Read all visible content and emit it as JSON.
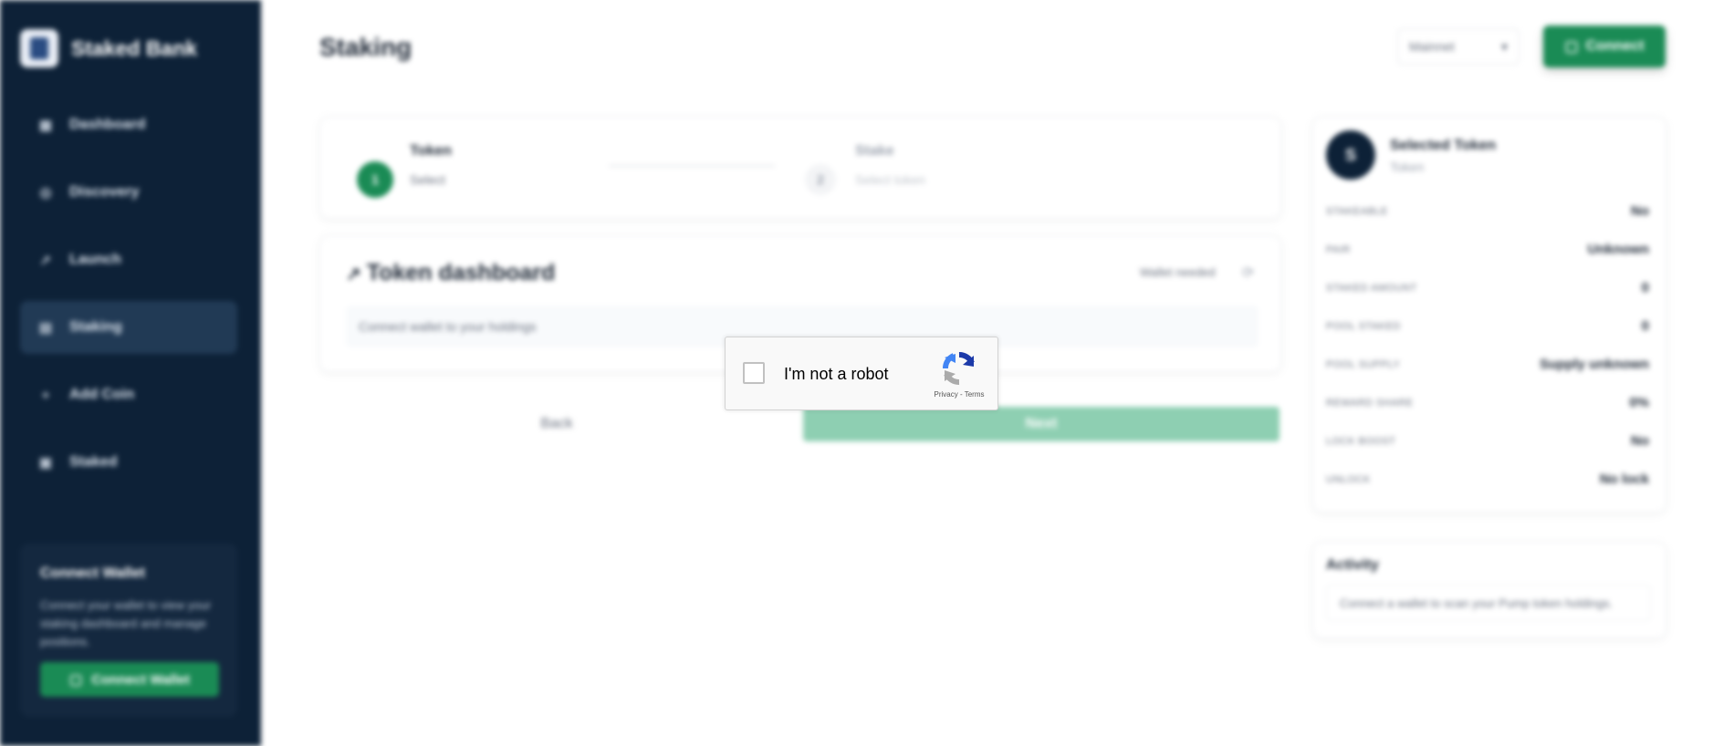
{
  "brand": {
    "name": "Staked Bank"
  },
  "sidebar": {
    "items": [
      {
        "label": "Dashboard",
        "icon": "grid-icon"
      },
      {
        "label": "Discovery",
        "icon": "compass-icon"
      },
      {
        "label": "Launch",
        "icon": "rocket-icon"
      },
      {
        "label": "Staking",
        "icon": "layers-icon",
        "active": true
      },
      {
        "label": "Add Coin",
        "icon": "plus-icon"
      },
      {
        "label": "Staked",
        "icon": "lock-icon"
      }
    ],
    "wallet": {
      "title": "Connect Wallet",
      "description": "Connect your wallet to view your staking dashboard and manage positions.",
      "button": "Connect Wallet"
    }
  },
  "header": {
    "title": "Staking",
    "network": "Mainnet",
    "connect": "Connect"
  },
  "steps": [
    {
      "number": "1",
      "title": "Token",
      "subtitle": "Select"
    },
    {
      "number": "2",
      "title": "Stake",
      "subtitle": "Select token"
    }
  ],
  "token_dashboard": {
    "title": "Token dashboard",
    "status": "Wallet needed",
    "message": "Connect wallet to your holdings"
  },
  "actions": {
    "back": "Back",
    "next": "Next"
  },
  "selected_token": {
    "avatar": "S",
    "title": "Selected Token",
    "subtitle": "Token",
    "rows": [
      {
        "key": "STAKEABLE",
        "value": "No"
      },
      {
        "key": "PAIR",
        "value": "Unknown"
      },
      {
        "key": "STAKED AMOUNT",
        "value": "0"
      },
      {
        "key": "POOL STAKED",
        "value": "0"
      },
      {
        "key": "POOL SUPPLY",
        "value": "Supply unknown"
      },
      {
        "key": "REWARD SHARE",
        "value": "0%"
      },
      {
        "key": "LOCK BOOST",
        "value": "No"
      },
      {
        "key": "UNLOCK",
        "value": "No lock"
      }
    ]
  },
  "activity": {
    "title": "Activity",
    "message": "Connect a wallet to scan your Pump token holdings."
  },
  "recaptcha": {
    "label": "I'm not a robot",
    "privacy": "Privacy",
    "separator": " - ",
    "terms": "Terms"
  },
  "colors": {
    "sidebar_bg": "#0d2137",
    "accent": "#1a8b55",
    "next_disabled": "#8ecfb2"
  }
}
